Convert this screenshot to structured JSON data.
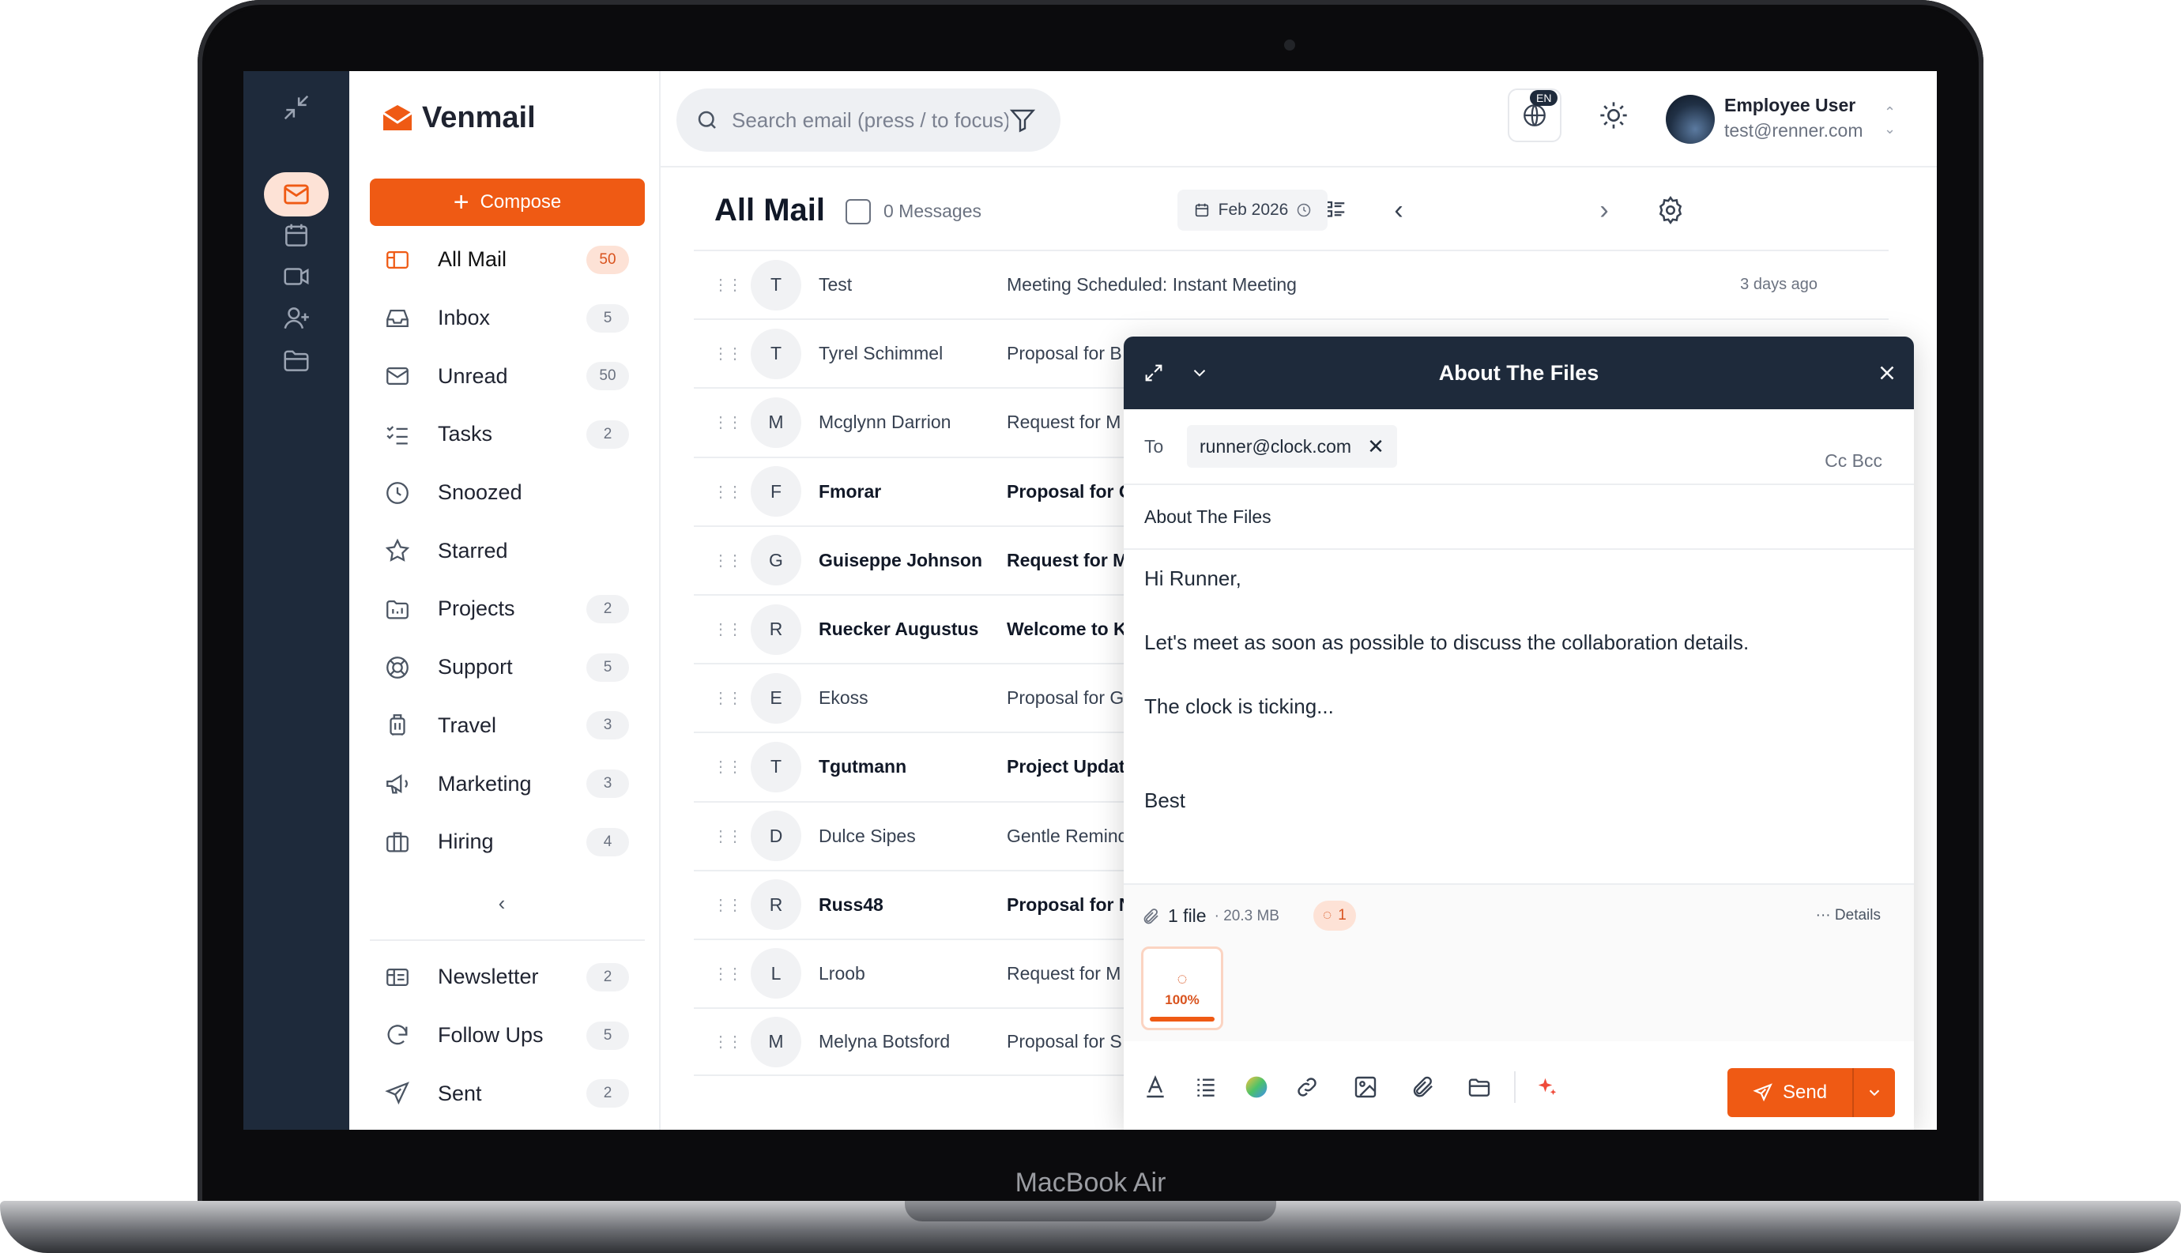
{
  "device_label": "MacBook Air",
  "app": {
    "name": "Venmail"
  },
  "search": {
    "placeholder": "Search email (press / to focus)"
  },
  "header": {
    "language_tag": "EN",
    "user_name": "Employee User",
    "user_email": "test@renner.com"
  },
  "sidebar": {
    "compose_label": "Compose",
    "items": [
      {
        "label": "All Mail",
        "count": "50",
        "icon": "all-mail-icon",
        "active": true
      },
      {
        "label": "Inbox",
        "count": "5",
        "icon": "inbox-icon"
      },
      {
        "label": "Unread",
        "count": "50",
        "icon": "unread-icon"
      },
      {
        "label": "Tasks",
        "count": "2",
        "icon": "tasks-icon"
      },
      {
        "label": "Snoozed",
        "count": "",
        "icon": "clock-icon"
      },
      {
        "label": "Starred",
        "count": "",
        "icon": "star-icon"
      },
      {
        "label": "Projects",
        "count": "2",
        "icon": "folder-icon"
      },
      {
        "label": "Support",
        "count": "5",
        "icon": "lifebuoy-icon"
      },
      {
        "label": "Travel",
        "count": "3",
        "icon": "luggage-icon"
      },
      {
        "label": "Marketing",
        "count": "3",
        "icon": "megaphone-icon"
      },
      {
        "label": "Hiring",
        "count": "4",
        "icon": "briefcase-icon"
      }
    ],
    "bottom_items": [
      {
        "label": "Newsletter",
        "count": "2",
        "icon": "newsletter-icon"
      },
      {
        "label": "Follow Ups",
        "count": "5",
        "icon": "refresh-icon"
      },
      {
        "label": "Sent",
        "count": "2",
        "icon": "send-icon"
      }
    ]
  },
  "mail_list": {
    "title": "All Mail",
    "message_count": "0 Messages",
    "date_filter": "Feb 2026",
    "rows": [
      {
        "initial": "T",
        "sender": "Test",
        "subject": "Meeting Scheduled: Instant Meeting",
        "time": "3 days ago",
        "unread": false
      },
      {
        "initial": "T",
        "sender": "Tyrel Schimmel",
        "subject": "Proposal for B",
        "time": "",
        "unread": false
      },
      {
        "initial": "M",
        "sender": "Mcglynn Darrion",
        "subject": "Request for M",
        "time": "",
        "unread": false
      },
      {
        "initial": "F",
        "sender": "Fmorar",
        "subject": "Proposal for G",
        "time": "",
        "unread": true
      },
      {
        "initial": "G",
        "sender": "Guiseppe Johnson",
        "subject": "Request for M",
        "time": "",
        "unread": true
      },
      {
        "initial": "R",
        "sender": "Ruecker Augustus",
        "subject": "Welcome to K",
        "time": "",
        "unread": true
      },
      {
        "initial": "E",
        "sender": "Ekoss",
        "subject": "Proposal for G",
        "time": "",
        "unread": false
      },
      {
        "initial": "T",
        "sender": "Tgutmann",
        "subject": "Project Updat",
        "time": "",
        "unread": true
      },
      {
        "initial": "D",
        "sender": "Dulce Sipes",
        "subject": "Gentle Remind",
        "time": "",
        "unread": false
      },
      {
        "initial": "R",
        "sender": "Russ48",
        "subject": "Proposal for N",
        "time": "",
        "unread": true
      },
      {
        "initial": "L",
        "sender": "Lroob",
        "subject": "Request for M",
        "time": "",
        "unread": false
      },
      {
        "initial": "M",
        "sender": "Melyna Botsford",
        "subject": "Proposal for S",
        "time": "",
        "unread": false
      }
    ]
  },
  "composer": {
    "title": "About The Files",
    "to_label": "To",
    "recipient": "runner@clock.com",
    "cc_bcc": "Cc  Bcc",
    "subject": "About The Files",
    "body": {
      "greeting": "Hi Runner,",
      "line1": "Let's meet as soon as possible to discuss the collaboration details.",
      "line2": "The clock is ticking...",
      "signoff": "Best"
    },
    "attachments": {
      "count_label": "1 file",
      "size": "· 20.3 MB",
      "uploading": "1",
      "details_label": "··· Details",
      "progress_label": "100%",
      "progress": 1.0
    },
    "send_label": "Send"
  },
  "colors": {
    "accent": "#ef5a14",
    "rail": "#1e2a3b",
    "accent_soft": "#fde2d6"
  }
}
